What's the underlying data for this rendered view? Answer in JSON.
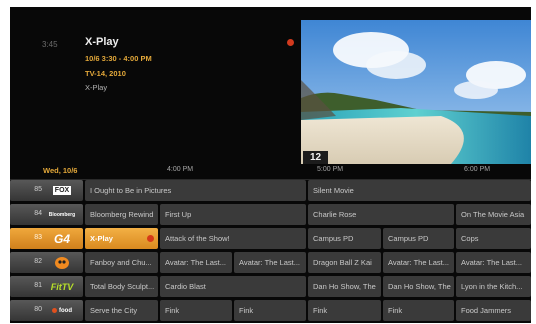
{
  "info": {
    "clock": "3:45",
    "title": "X-Play",
    "airtime": "10/6 3:30 - 4:00 PM",
    "rating": "TV-14, 2010",
    "subtitle": "X-Play"
  },
  "preview": {
    "channel": "12"
  },
  "timebar": {
    "date": "Wed, 10/6",
    "times": [
      "4:00 PM",
      "5:00 PM",
      "6:00 PM"
    ]
  },
  "channels": [
    {
      "number": "85",
      "logo": "fox-movie-channel-logo",
      "logo_text": "FOX",
      "programs": [
        "I Ought to Be in Pictures",
        "Silent Movie"
      ]
    },
    {
      "number": "84",
      "logo": "bloomberg-logo",
      "logo_text": "Bloomberg",
      "programs": [
        "Bloomberg Rewind",
        "First Up",
        "Charlie Rose",
        "On The Movie Asia"
      ]
    },
    {
      "number": "83",
      "logo": "g4-logo",
      "logo_text": "G4",
      "programs": [
        "X-Play",
        "Attack of the Show!",
        "Campus PD",
        "Campus PD",
        "Cops"
      ]
    },
    {
      "number": "82",
      "logo": "cartoon-logo",
      "logo_text": "",
      "programs": [
        "Fanboy and Chu...",
        "Avatar: The Last...",
        "Avatar: The Last...",
        "Dragon Ball Z Kai",
        "Avatar: The Last...",
        "Avatar: The Last..."
      ]
    },
    {
      "number": "81",
      "logo": "fittv-logo",
      "logo_text": "FitTV",
      "programs": [
        "Total Body Sculpt...",
        "Cardio Blast",
        "Dan Ho Show, The",
        "Dan Ho Show, The",
        "Lyon in the Kitch..."
      ]
    },
    {
      "number": "80",
      "logo": "food-network-logo",
      "logo_text": "food",
      "programs": [
        "Serve the City",
        "Fink",
        "Fink",
        "Fink",
        "Fink",
        "Food Jammers"
      ]
    }
  ],
  "colors": {
    "accent": "#e3a83a",
    "selected": "#e08f24",
    "record": "#d23a1e",
    "cell": "#3a3a3a",
    "background": "#080808"
  }
}
